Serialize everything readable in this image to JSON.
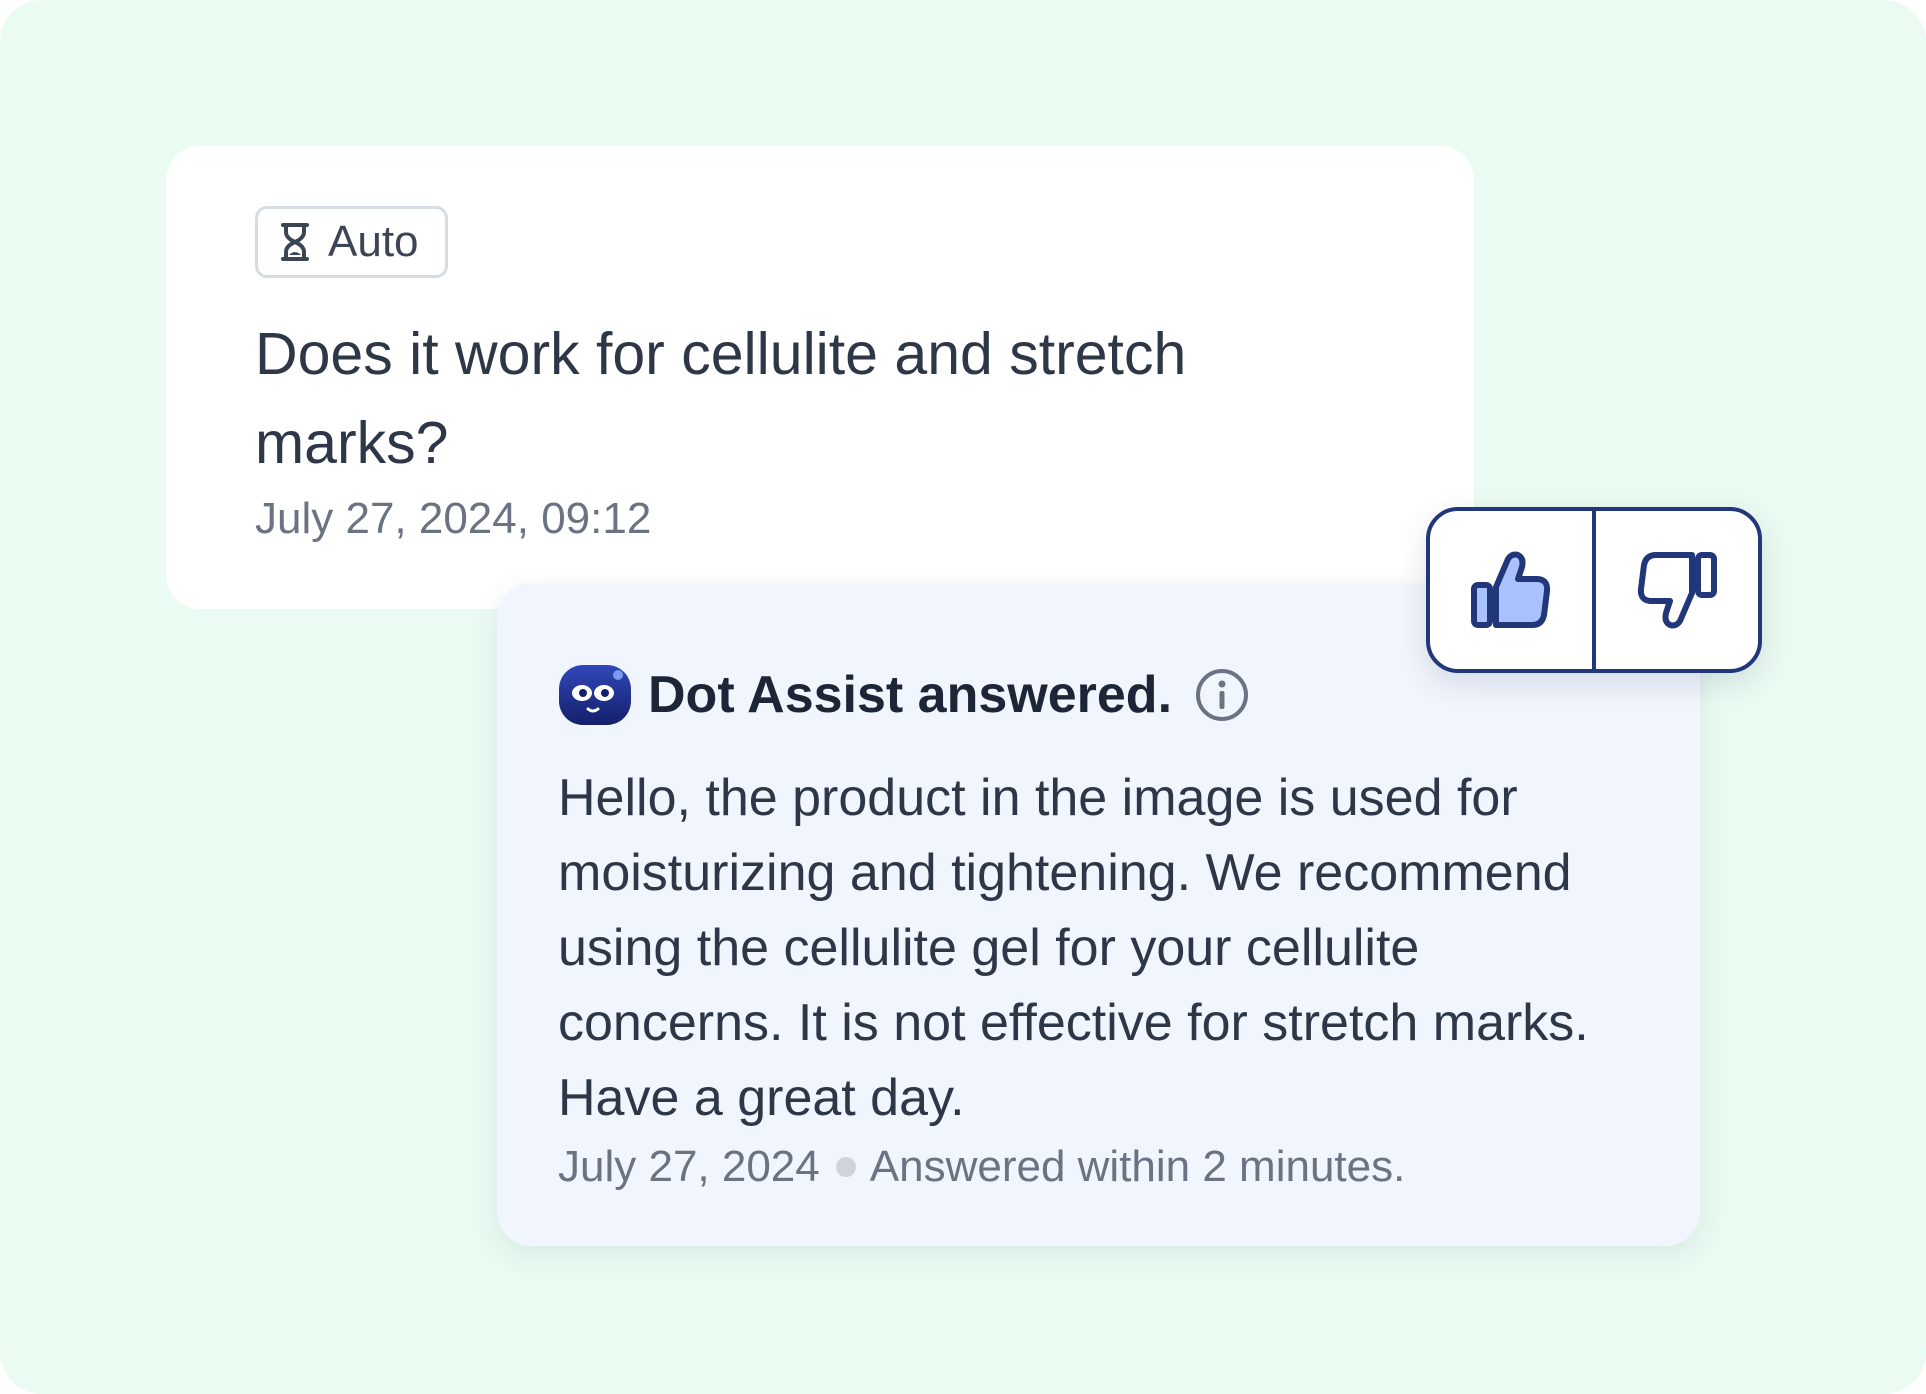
{
  "question": {
    "mode_label": "Auto",
    "text": "Does it work for cellulite and stretch marks?",
    "timestamp": "July 27, 2024, 09:12"
  },
  "answer": {
    "title": "Dot Assist answered.",
    "body": "Hello, the product in the image is used for moisturizing and tightening. We recommend using the cellulite gel for your cellulite concerns. It is not effective for stretch marks. Have a great day.",
    "date": "July 27, 2024",
    "response_time": "Answered within 2 minutes."
  },
  "feedback": {
    "like_icon": "thumbs-up-icon",
    "dislike_icon": "thumbs-down-icon",
    "accent_color": "#22377a",
    "like_fill_color": "#a9c2ff"
  },
  "colors": {
    "background": "#eafbf1",
    "question_card": "#ffffff",
    "answer_card": "#f1f5fd",
    "text_primary": "#2d3747",
    "text_secondary": "#6b7383"
  }
}
